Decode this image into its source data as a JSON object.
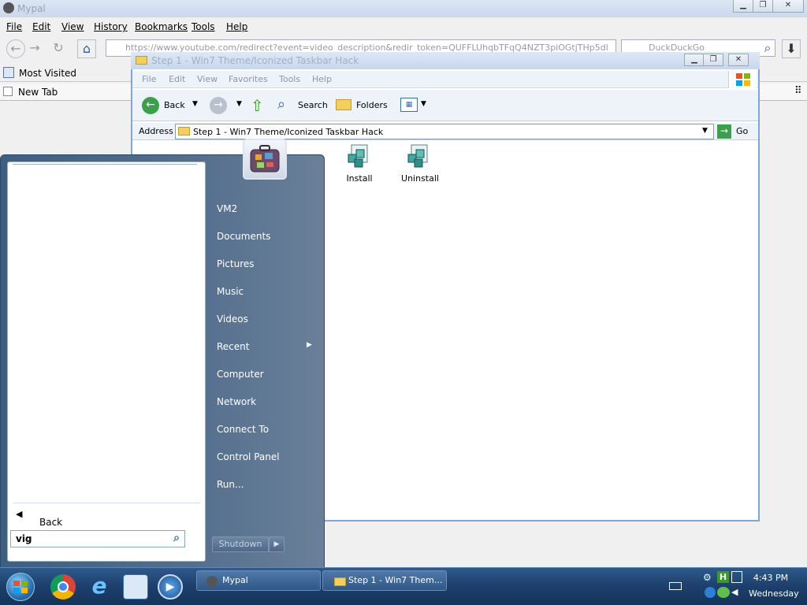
{
  "browser": {
    "title": "Mypal",
    "menu": [
      "File",
      "Edit",
      "View",
      "History",
      "Bookmarks",
      "Tools",
      "Help"
    ],
    "url": "https://www.youtube.com/redirect?event=video_description&redir_token=QUFFLUhqbTFqQ4NZT3piOGtjTHp5dl",
    "search_placeholder": "DuckDuckGo",
    "bookmark": "Most Visited",
    "tab": "New Tab"
  },
  "explorer": {
    "title": "Step 1 - Win7 Theme/Iconized Taskbar Hack",
    "menu": [
      "File",
      "Edit",
      "View",
      "Favorites",
      "Tools",
      "Help"
    ],
    "toolbar": {
      "back": "Back",
      "search": "Search",
      "folders": "Folders"
    },
    "address_label": "Address",
    "address_value": "Step 1 - Win7 Theme/Iconized Taskbar Hack",
    "go_label": "Go",
    "files": [
      {
        "label": "Install"
      },
      {
        "label": "Uninstall"
      }
    ]
  },
  "startmenu": {
    "right_items": [
      "VM2",
      "Documents",
      "Pictures",
      "Music",
      "Videos",
      "Recent",
      "Computer",
      "Network",
      "Connect To",
      "Control Panel",
      "Run..."
    ],
    "back_label": "Back",
    "search_value": "vig",
    "shutdown_label": "Shutdown"
  },
  "taskbar": {
    "tasks": [
      "Mypal",
      "Step 1 - Win7 Them..."
    ],
    "time": "4:43 PM",
    "day": "Wednesday"
  },
  "colors": {
    "accent": "#1d3f6c",
    "explorer_border": "#7fa6d4"
  }
}
